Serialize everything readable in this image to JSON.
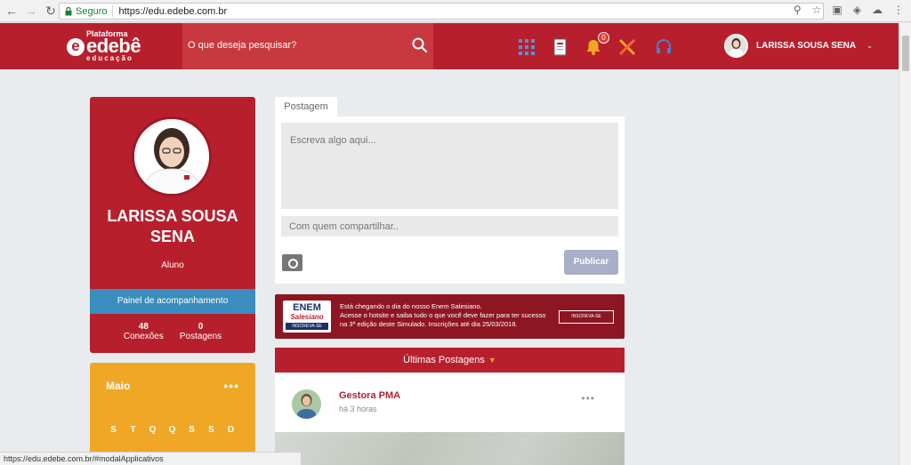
{
  "browser": {
    "secure_label": "Seguro",
    "url": "https://edu.edebe.com.br",
    "status_url": "https://edu.edebe.com.br/#modalApplicativos"
  },
  "header": {
    "logo_top": "Plataforma",
    "logo_brand": "edebê",
    "logo_sub": "educação",
    "search_placeholder": "O que deseja pesquisar?",
    "notification_count": "0",
    "user_name": "LARISSA SOUSA SENA"
  },
  "profile": {
    "name": "LARISSA SOUSA SENA",
    "role": "Aluno",
    "panel_link": "Painel de acompanhamento",
    "connections_count": "48",
    "connections_label": "Conexões",
    "posts_count": "0",
    "posts_label": "Postagens"
  },
  "calendar": {
    "month": "Maio",
    "more": "•••",
    "weekdays": [
      "S",
      "T",
      "Q",
      "Q",
      "S",
      "S",
      "D"
    ]
  },
  "composer": {
    "tab_label": "Postagem",
    "post_placeholder": "Escreva algo aqui...",
    "share_placeholder": "Com quem compartilhar..",
    "publish_label": "Publicar"
  },
  "banner": {
    "logo_line1": "ENEM",
    "logo_line2": "Salesiano",
    "logo_line3": "INSCREVA-SE",
    "text_line1": "Está chegando o dia do nosso Enem Salesiano.",
    "text_line2": "Acesse o hotsite e saiba tudo o que você deve fazer para ter sucesso",
    "text_line3": "na 3ª edição deste Simulado. Inscrições até dia 25/03/2018.",
    "cta": "INSCREVA-SE"
  },
  "feed": {
    "section_title": "Últimas Postagens",
    "post_author": "Gestora PMA",
    "post_time": "há 3 horas",
    "post_menu": "•••"
  },
  "colors": {
    "brand_red": "#b81f2d",
    "accent_blue": "#3a8dbd",
    "calendar_orange": "#f0a726"
  }
}
